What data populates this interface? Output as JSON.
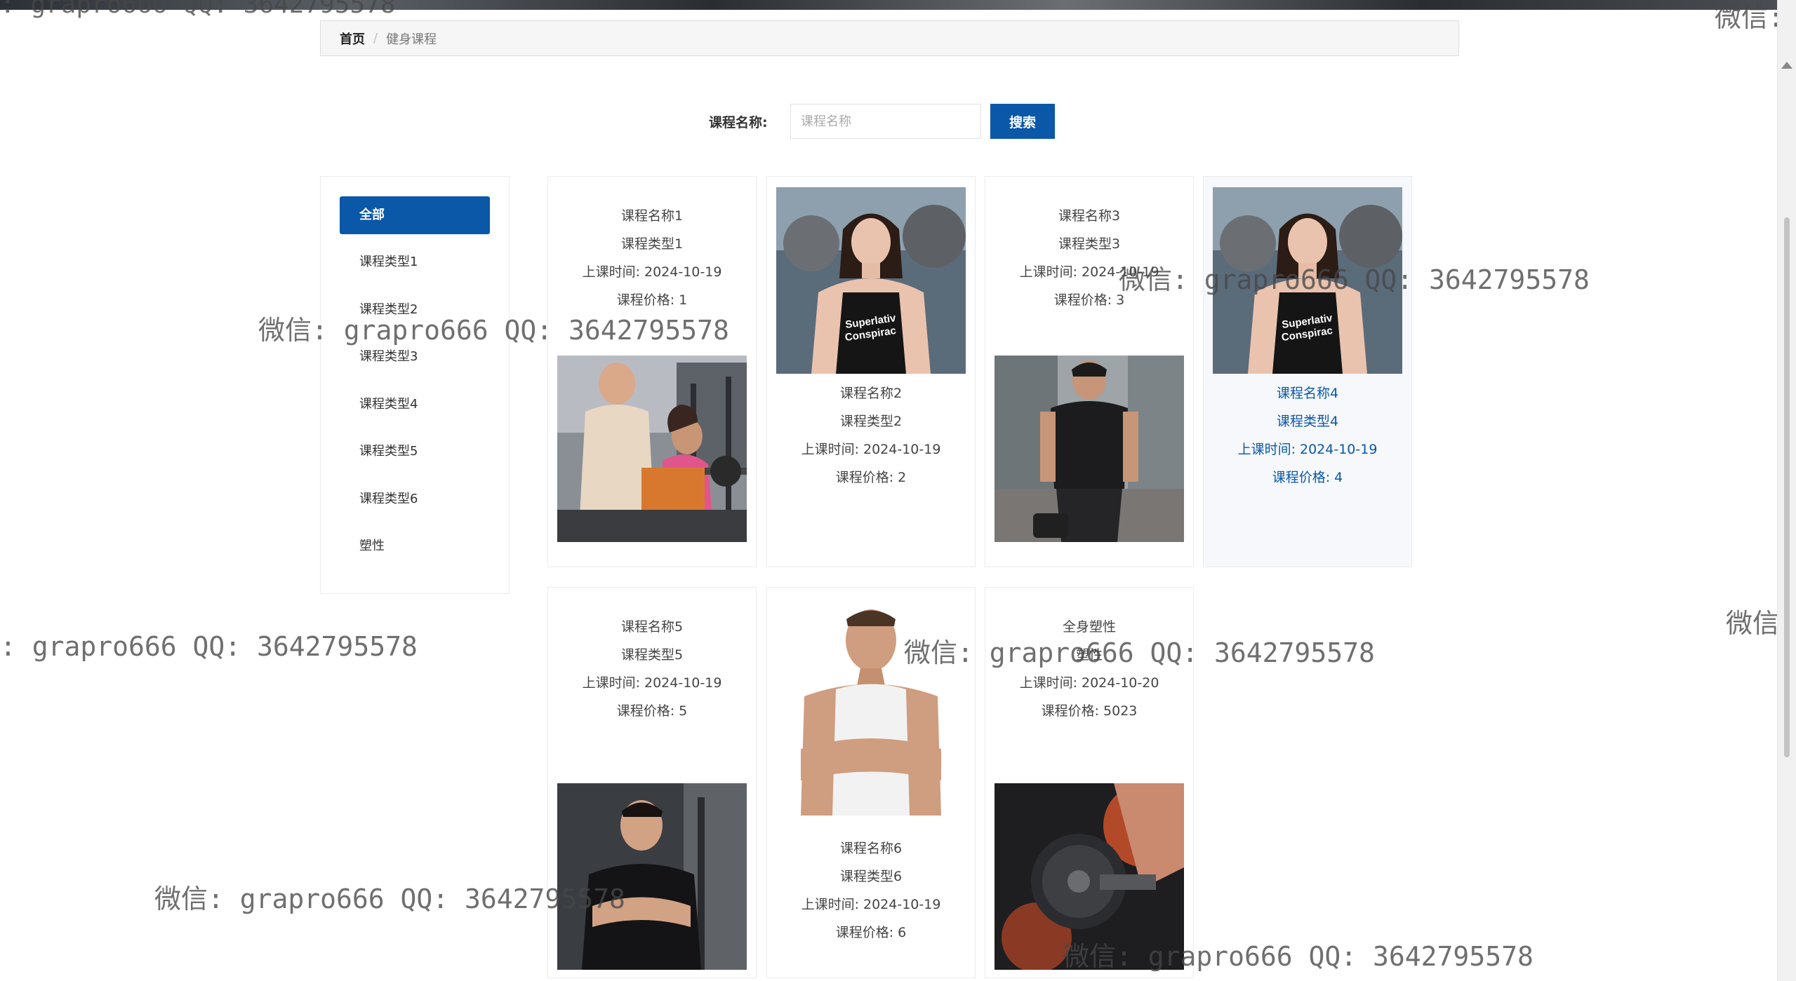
{
  "breadcrumb": {
    "home": "首页",
    "separator": "/",
    "current": "健身课程"
  },
  "search": {
    "label": "课程名称:",
    "placeholder": "课程名称",
    "value": "",
    "button": "搜索"
  },
  "sidebar": {
    "items": [
      {
        "label": "全部",
        "active": true
      },
      {
        "label": "课程类型1",
        "active": false
      },
      {
        "label": "课程类型2",
        "active": false
      },
      {
        "label": "课程类型3",
        "active": false
      },
      {
        "label": "课程类型4",
        "active": false
      },
      {
        "label": "课程类型5",
        "active": false
      },
      {
        "label": "课程类型6",
        "active": false
      },
      {
        "label": "塑性",
        "active": false
      }
    ]
  },
  "courses": [
    {
      "name": "课程名称1",
      "type": "课程类型1",
      "time": "上课时间: 2024-10-19",
      "price": "课程价格: 1",
      "image": "trainer-assisting-woman-curl-photo"
    },
    {
      "name": "课程名称2",
      "type": "课程类型2",
      "time": "上课时间: 2024-10-19",
      "price": "课程价格: 2",
      "image": "woman-gym-tank-top-photo",
      "tank_text": "Superlativ Conspirac"
    },
    {
      "name": "课程名称3",
      "type": "课程类型3",
      "time": "上课时间: 2024-10-19",
      "price": "课程价格: 3",
      "image": "man-black-tshirt-street-photo"
    },
    {
      "name": "课程名称4",
      "type": "课程类型4",
      "time": "上课时间: 2024-10-19",
      "price": "课程价格: 4",
      "image": "woman-gym-tank-top-photo",
      "tank_text": "Superlativ Conspirac"
    },
    {
      "name": "课程名称5",
      "type": "课程类型5",
      "time": "上课时间: 2024-10-19",
      "price": "课程价格: 5",
      "image": "man-arms-crossed-gym-photo"
    },
    {
      "name": "课程名称6",
      "type": "课程类型6",
      "time": "上课时间: 2024-10-19",
      "price": "课程价格: 6",
      "image": "muscular-man-white-tank-photo"
    },
    {
      "name": "全身塑性",
      "type": "塑性",
      "time": "上课时间: 2024-10-20",
      "price": "课程价格: 5023",
      "image": "dumbbell-closeup-photo"
    }
  ],
  "watermark": {
    "text": "微信: grapro666 QQ: 3642795578",
    "fragment_top_left": ": grapro666 QQ: 3642795578",
    "fragment_left": ": grapro666 QQ: 3642795578",
    "fragment_right": "微信:"
  },
  "colors": {
    "accent": "#0b57a8",
    "hover_bg": "#f6f8fb"
  }
}
